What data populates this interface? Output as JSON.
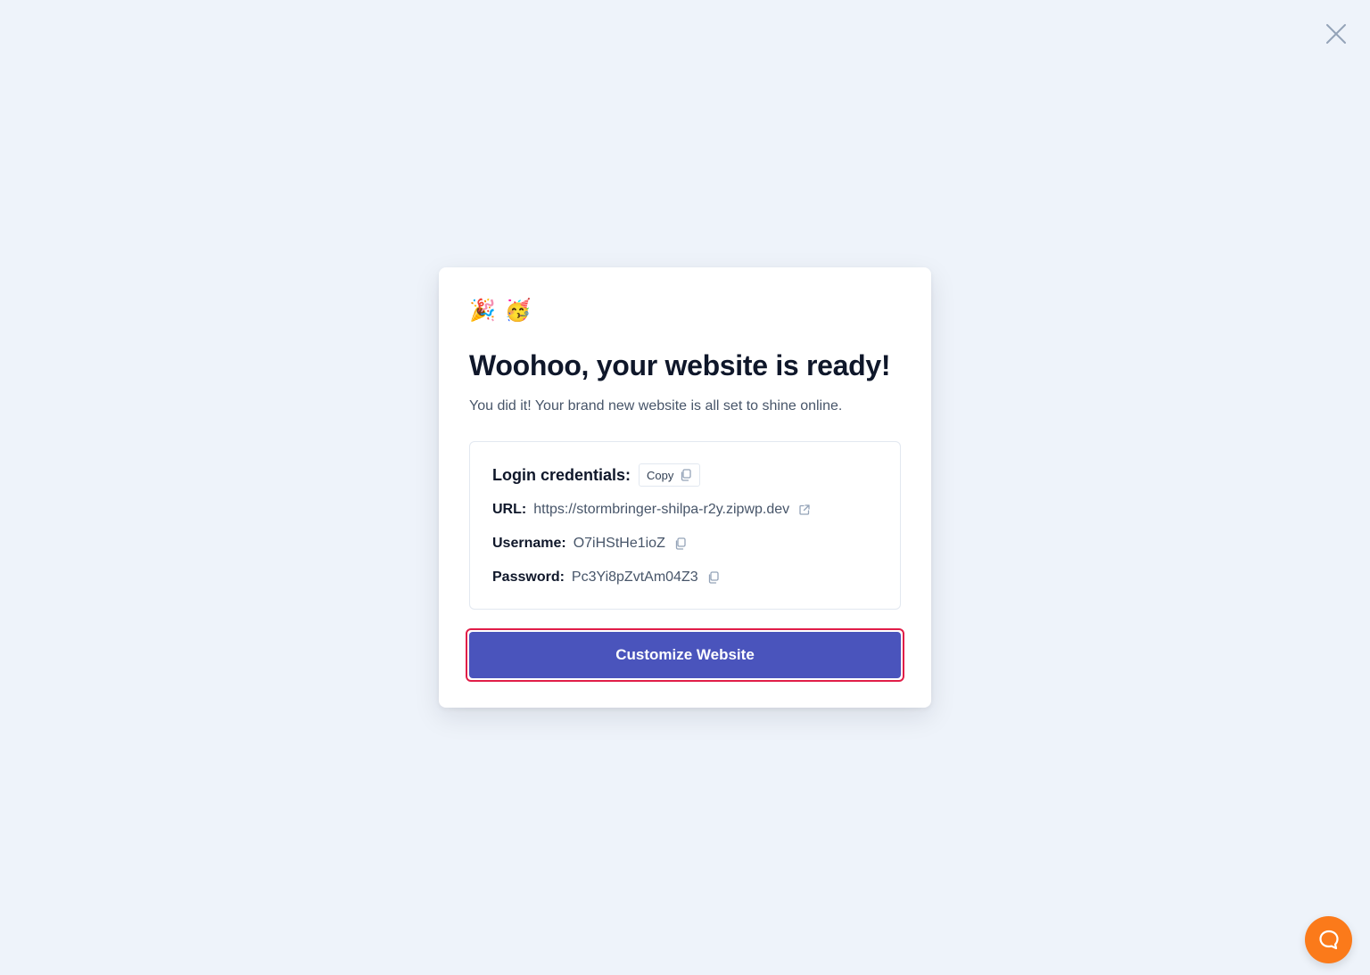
{
  "window": {
    "close_icon": "close-x-icon"
  },
  "modal": {
    "emojis": [
      "🎉",
      "🥳"
    ],
    "title": "Woohoo, your website is ready!",
    "subtitle": "You did it! Your brand new website is all set to shine online.",
    "credentials": {
      "heading": "Login credentials:",
      "copy_label": "Copy",
      "url_label": "URL:",
      "url_value": "https://stormbringer-shilpa-r2y.zipwp.dev",
      "username_label": "Username:",
      "username_value": "O7iHStHe1ioZ",
      "password_label": "Password:",
      "password_value": "Pc3Yi8pZvtAm04Z3"
    },
    "cta_label": "Customize Website"
  },
  "help": {
    "icon": "chat-bubble-icon"
  },
  "colors": {
    "background": "#eef3fa",
    "primary": "#4a54bc",
    "focus_ring": "#e11d48",
    "help_button": "#fb7a1a"
  }
}
